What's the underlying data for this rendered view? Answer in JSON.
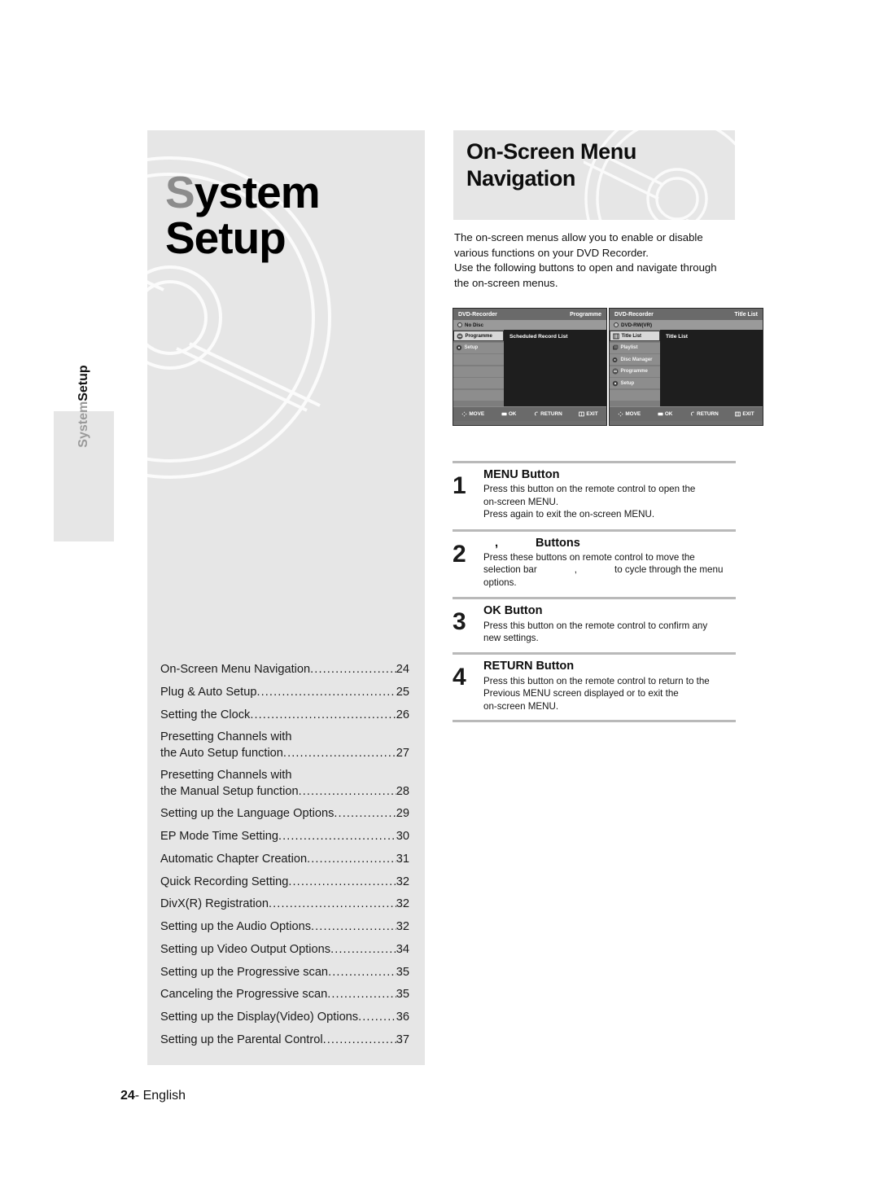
{
  "left_hero": {
    "title_cap": "S",
    "title_rest": "ystem",
    "title_line2": "Setup"
  },
  "side_tab": {
    "word_gray": "System",
    "word_black": " Setup"
  },
  "right_hero": {
    "title_line1": "On-Screen Menu",
    "title_line2": "Navigation"
  },
  "intro": {
    "line1": "The on-screen menus allow you to enable or disable",
    "line2": "various functions on your DVD Recorder.",
    "line3": "Use the following buttons to open and navigate through",
    "line4": "the on-screen menus."
  },
  "osd_screens": [
    {
      "brand": "DVD-Recorder",
      "mode": "Programme",
      "disc": "No Disc",
      "disc_icon": "disc-icon",
      "items": [
        {
          "label": "Programme",
          "icon": "programme-icon",
          "selected": true
        },
        {
          "label": "Setup",
          "icon": "gear-icon",
          "selected": false
        },
        {
          "label": "",
          "icon": "",
          "selected": false
        },
        {
          "label": "",
          "icon": "",
          "selected": false
        },
        {
          "label": "",
          "icon": "",
          "selected": false
        },
        {
          "label": "",
          "icon": "",
          "selected": false
        }
      ],
      "content": "Scheduled Record List",
      "footer": [
        {
          "icon": "dpad-icon",
          "label": "MOVE"
        },
        {
          "icon": "ok-icon",
          "label": "OK"
        },
        {
          "icon": "return-icon",
          "label": "RETURN"
        },
        {
          "icon": "exit-icon",
          "label": "EXIT"
        }
      ]
    },
    {
      "brand": "DVD-Recorder",
      "mode": "Title List",
      "disc": "DVD-RW(VR)",
      "disc_icon": "disc-icon",
      "items": [
        {
          "label": "Title List",
          "icon": "titlelist-icon",
          "selected": true
        },
        {
          "label": "Playlist",
          "icon": "playlist-icon",
          "selected": false
        },
        {
          "label": "Disc Manager",
          "icon": "discmanager-icon",
          "selected": false
        },
        {
          "label": "Programme",
          "icon": "programme-icon",
          "selected": false
        },
        {
          "label": "Setup",
          "icon": "gear-icon",
          "selected": false
        },
        {
          "label": "",
          "icon": "",
          "selected": false
        }
      ],
      "content": "Title List",
      "footer": [
        {
          "icon": "dpad-icon",
          "label": "MOVE"
        },
        {
          "icon": "ok-icon",
          "label": "OK"
        },
        {
          "icon": "return-icon",
          "label": "RETURN"
        },
        {
          "icon": "exit-icon",
          "label": "EXIT"
        }
      ]
    }
  ],
  "steps": [
    {
      "num": "1",
      "title": "MENU Button",
      "body_line1": "Press this button on the remote control to open the",
      "body_line2": "on-screen MENU.",
      "body_line3": "Press again to exit the on-screen MENU.",
      "body_line4": ""
    },
    {
      "num": "2",
      "title_pre": "",
      "title_mid": ",",
      "title_post": "Buttons",
      "title": "Buttons",
      "body_line1": "Press these buttons on remote control to move the",
      "body_line2a": "selection bar",
      "body_line2b": ",",
      "body_line2c": "to cycle through the menu",
      "body_line3": "options.",
      "body_line4": ""
    },
    {
      "num": "3",
      "title": "OK Button",
      "body_line1": "Press this button on the remote control to confirm any",
      "body_line2": "new settings.",
      "body_line3": "",
      "body_line4": ""
    },
    {
      "num": "4",
      "title": "RETURN Button",
      "body_line1": "Press this button on the remote control to return to the",
      "body_line2": "Previous MENU screen displayed or to exit the",
      "body_line3": "on-screen MENU.",
      "body_line4": ""
    }
  ],
  "toc": [
    {
      "type": "dotted",
      "label": "On-Screen Menu Navigation",
      "page": "24"
    },
    {
      "type": "dotted",
      "label": "Plug & Auto Setup",
      "page": "25"
    },
    {
      "type": "dotted",
      "label": "Setting the Clock",
      "page": "26"
    },
    {
      "type": "plain",
      "label": "Presetting Channels with",
      "page": ""
    },
    {
      "type": "dotted",
      "label": "the Auto Setup function",
      "page": "27"
    },
    {
      "type": "plain",
      "label": "Presetting Channels with",
      "page": ""
    },
    {
      "type": "dotted",
      "label": "the Manual Setup function",
      "page": "28"
    },
    {
      "type": "dotted",
      "label": "Setting up the Language Options",
      "page": "29"
    },
    {
      "type": "dotted",
      "label": "EP Mode Time Setting",
      "page": "30"
    },
    {
      "type": "dotted",
      "label": "Automatic Chapter Creation",
      "page": "31"
    },
    {
      "type": "dotted",
      "label": "Quick Recording Setting",
      "page": "32"
    },
    {
      "type": "dotted",
      "label": "DivX(R) Registration",
      "page": "32"
    },
    {
      "type": "dotted",
      "label": "Setting up the Audio Options",
      "page": "32"
    },
    {
      "type": "dotted",
      "label": "Setting up Video Output Options",
      "page": "34"
    },
    {
      "type": "dotted",
      "label": "Setting up the Progressive scan",
      "page": "35"
    },
    {
      "type": "dotted",
      "label": "Canceling the Progressive scan",
      "page": "35"
    },
    {
      "type": "dotted",
      "label": "Setting up the Display(Video) Options",
      "page": "36"
    },
    {
      "type": "dotted",
      "label": "Setting up the Parental Control",
      "page": "37"
    }
  ],
  "footer": {
    "page_number": "24",
    "dash": "-",
    "language": "English"
  },
  "colors": {
    "panel_gray": "#e6e6e6",
    "accent_gray": "#8c8c8c",
    "osd_dark": "#232323",
    "osd_mid": "#6e6e6e"
  }
}
